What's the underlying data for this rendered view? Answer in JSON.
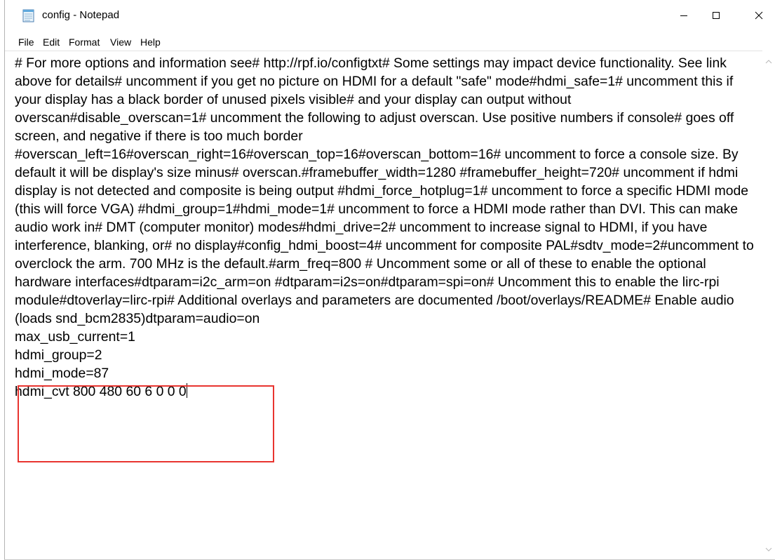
{
  "window": {
    "title": "config - Notepad",
    "icon": "notepad-icon"
  },
  "controls": {
    "minimize_icon": "minimize-icon",
    "maximize_icon": "maximize-icon",
    "close_icon": "close-icon"
  },
  "menu": {
    "items": [
      {
        "label": "File"
      },
      {
        "label": "Edit"
      },
      {
        "label": "Format"
      },
      {
        "label": "View"
      },
      {
        "label": "Help"
      }
    ]
  },
  "editor": {
    "content": "# For more options and information see# http://rpf.io/configtxt# Some settings may impact device functionality. See link above for details# uncomment if you get no picture on HDMI for a default \"safe\" mode#hdmi_safe=1# uncomment this if your display has a black border of unused pixels visible# and your display can output without overscan#disable_overscan=1# uncomment the following to adjust overscan. Use positive numbers if console# goes off screen, and negative if there is too much border #overscan_left=16#overscan_right=16#overscan_top=16#overscan_bottom=16# uncomment to force a console size. By default it will be display's size minus# overscan.#framebuffer_width=1280 #framebuffer_height=720# uncomment if hdmi display is not detected and composite is being output #hdmi_force_hotplug=1# uncomment to force a specific HDMI mode (this will force VGA) #hdmi_group=1#hdmi_mode=1# uncomment to force a HDMI mode rather than DVI. This can make audio work in# DMT (computer monitor) modes#hdmi_drive=2# uncomment to increase signal to HDMI, if you have interference, blanking, or# no display#config_hdmi_boost=4# uncomment for composite PAL#sdtv_mode=2#uncomment to overclock the arm. 700 MHz is the default.#arm_freq=800 # Uncomment some or all of these to enable the optional hardware interfaces#dtparam=i2c_arm=on #dtparam=i2s=on#dtparam=spi=on# Uncomment this to enable the lirc-rpi module#dtoverlay=lirc-rpi# Additional overlays and parameters are documented /boot/overlays/README# Enable audio (loads snd_bcm2835)dtparam=audio=on\nmax_usb_current=1\nhdmi_group=2\nhdmi_mode=87\nhdmi_cvt 800 480 60 6 0 0 0"
  },
  "annotation": {
    "highlight_color": "#e8342f"
  }
}
